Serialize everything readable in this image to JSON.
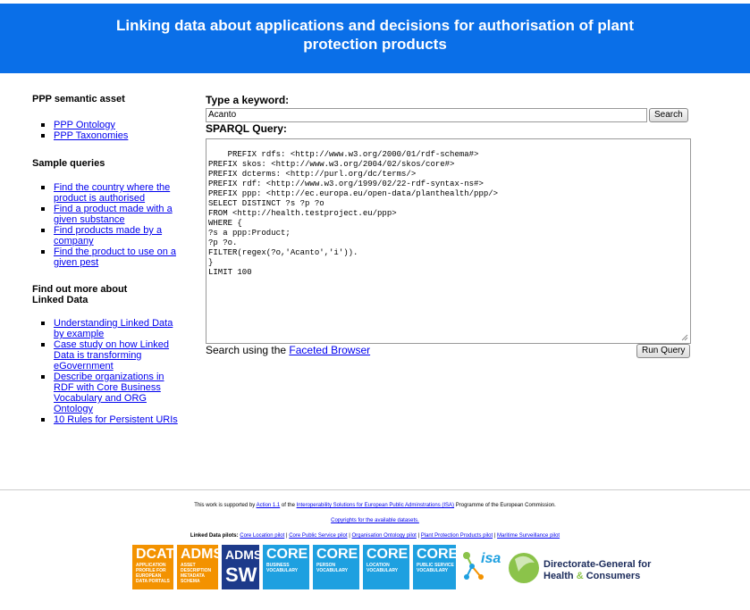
{
  "header": {
    "title": "Linking data about applications and decisions for authorisation of plant protection products"
  },
  "sidebar": {
    "sections": [
      {
        "heading": "PPP semantic asset",
        "links": [
          "PPP Ontology",
          "PPP Taxonomies"
        ]
      },
      {
        "heading": "Sample queries",
        "links": [
          "Find the country where the product is authorised",
          "Find a product made with a given substance",
          "Find products made by a company",
          "Find the product to use on a given pest"
        ]
      },
      {
        "heading": "Find out more about Linked Data",
        "links": [
          "Understanding Linked Data by example",
          "Case study on how Linked Data is transforming eGovernment",
          "Describe organizations in RDF with Core Business Vocabulary and ORG Ontology",
          "10 Rules for Persistent URIs"
        ]
      }
    ]
  },
  "main": {
    "keyword_label": "Type a keyword:",
    "keyword_value": "Acanto",
    "search_button": "Search",
    "sparql_label": "SPARQL Query:",
    "query_text": "PREFIX rdfs: <http://www.w3.org/2000/01/rdf-schema#>\nPREFIX skos: <http://www.w3.org/2004/02/skos/core#>\nPREFIX dcterms: <http://purl.org/dc/terms/>\nPREFIX rdf: <http://www.w3.org/1999/02/22-rdf-syntax-ns#>\nPREFIX ppp: <http://ec.europa.eu/open-data/planthealth/ppp/>\nSELECT DISTINCT ?s ?p ?o\nFROM <http://health.testproject.eu/ppp>\nWHERE {\n?s a ppp:Product;\n?p ?o.\nFILTER(regex(?o,'Acanto','i')).\n}\nLIMIT 100",
    "faceted_prefix": "Search using the ",
    "faceted_link": "Faceted Browser",
    "run_button": "Run Query"
  },
  "footer": {
    "line1_a": "This work is supported by ",
    "line1_link1": "Action 1.1",
    "line1_b": " of the ",
    "line1_link2": "Interoperability Solutions for European Public Adminstrations (ISA)",
    "line1_c": " Programme of the European Commission.",
    "copyright_link": "Copyrights for the available datasets.",
    "pilots_label": "Linked Data pilots: ",
    "pilots": [
      "Core Location pilot",
      "Core Public Service pilot",
      "Organisation Ontology pilot",
      "Plant Protection Products pilot",
      "Maritime Surveillance pilot"
    ],
    "pilot_separator": " | "
  },
  "logos": {
    "dcat": {
      "big": "DCAT",
      "small": "APPLICATION PROFILE FOR EUROPEAN DATA PORTALS",
      "color": "#f39200"
    },
    "adms": {
      "big": "ADMS",
      "small": "ASSET DESCRIPTION METADATA SCHEMA",
      "color": "#f39200"
    },
    "adms_sw": {
      "big": "ADMS.",
      "big2": "SW",
      "color": "#1d3a8a"
    },
    "core_business": {
      "big": "CORE",
      "small": "BUSINESS VOCABULARY",
      "color": "#1ea0e0"
    },
    "core_person": {
      "big": "CORE",
      "small": "PERSON VOCABULARY",
      "color": "#1ea0e0"
    },
    "core_location": {
      "big": "CORE",
      "small": "LOCATION VOCABULARY",
      "color": "#1ea0e0"
    },
    "core_public_service": {
      "big": "CORE",
      "small": "PUBLIC SERVICE VOCABULARY",
      "color": "#1ea0e0"
    },
    "isa": {
      "text": "isa"
    },
    "dg_health": {
      "line1": "Directorate-General for",
      "line2a": "Health ",
      "line2b": "&",
      "line2c": " Consumers"
    }
  }
}
